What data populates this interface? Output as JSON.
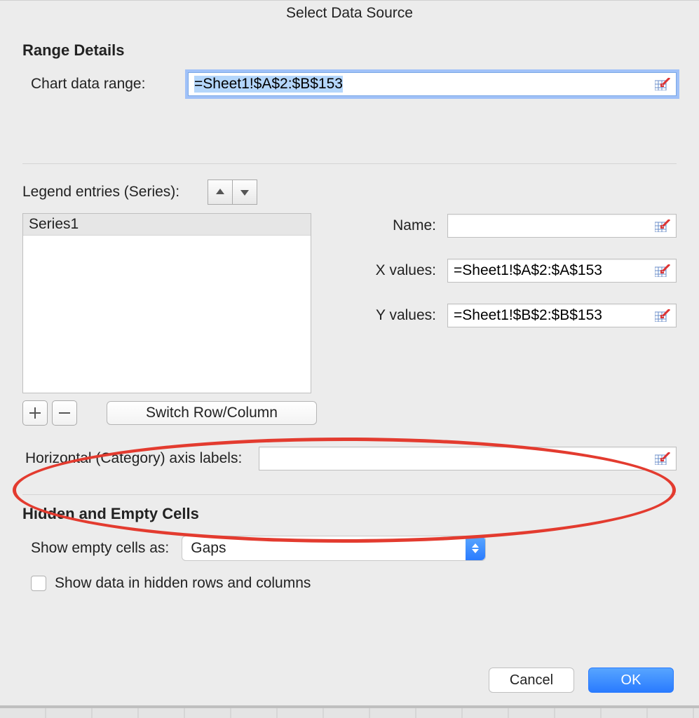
{
  "title": "Select Data Source",
  "range_details": {
    "heading": "Range Details",
    "chart_data_range_label": "Chart data range:",
    "chart_data_range_value": "=Sheet1!$A$2:$B$153"
  },
  "legend": {
    "label": "Legend entries (Series):",
    "series": [
      "Series1"
    ],
    "switch_label": "Switch Row/Column",
    "name_label": "Name:",
    "name_value": "",
    "x_label": "X values:",
    "x_value": "=Sheet1!$A$2:$A$153",
    "y_label": "Y values:",
    "y_value": "=Sheet1!$B$2:$B$153"
  },
  "horizontal_axis": {
    "label": "Horizontal (Category) axis labels:",
    "value": ""
  },
  "hidden_empty": {
    "heading": "Hidden and Empty Cells",
    "show_empty_label": "Show empty cells as:",
    "show_empty_value": "Gaps",
    "show_hidden_label": "Show data in hidden rows and columns"
  },
  "buttons": {
    "cancel": "Cancel",
    "ok": "OK"
  }
}
